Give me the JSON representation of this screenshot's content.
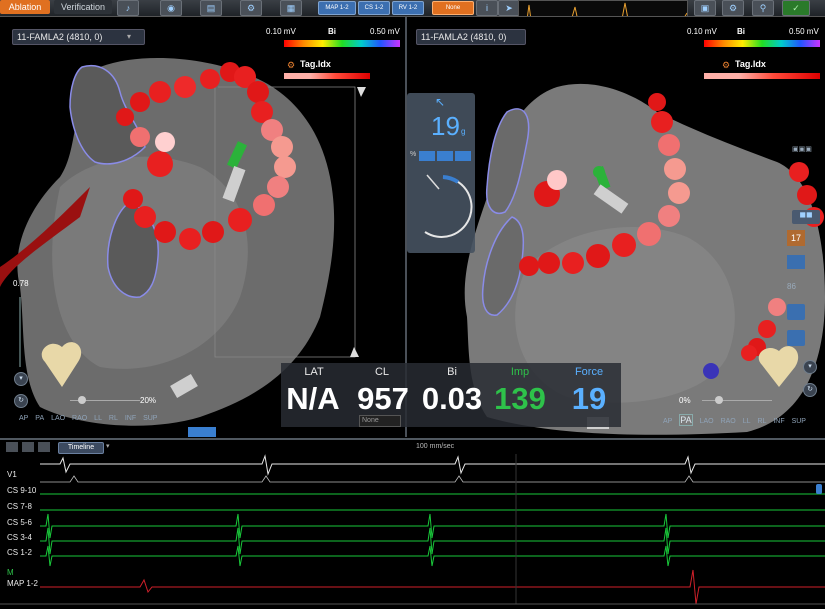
{
  "toolbar": {
    "tab_ablation": "Ablation",
    "tab_verification": "Verification",
    "buttons": [
      "MAP 1-2",
      "CS 1-2",
      "RV 1-2",
      "None"
    ]
  },
  "left_map": {
    "title": "11-FAMLA2 (4810, 0)",
    "scale_min": "0.10 mV",
    "scale_label": "Bi",
    "scale_max": "0.50 mV",
    "tag_label": "Tag.Idx",
    "slider_value": "0.78",
    "zoom": "20%",
    "orientation": [
      "AP",
      "PA",
      "LAO",
      "RAO",
      "LL",
      "RL",
      "INF",
      "SUP"
    ]
  },
  "right_map": {
    "title": "11-FAMLA2 (4810, 0)",
    "scale_min": "0.10 mV",
    "scale_label": "Bi",
    "scale_max": "0.50 mV",
    "tag_label": "Tag.Idx",
    "zoom": "0%",
    "orientation": [
      "AP",
      "PA",
      "LAO",
      "RAO",
      "LL",
      "RL",
      "INF",
      "SUP"
    ],
    "side_value_1": "17",
    "side_value_2": "86"
  },
  "force_panel": {
    "value": "19",
    "unit": "g",
    "percent_symbol": "%"
  },
  "metrics": {
    "lat_label": "LAT",
    "lat_value": "N/A",
    "cl_label": "CL",
    "cl_value": "957",
    "cl_select": "None",
    "bi_label": "Bi",
    "bi_value": "0.03",
    "imp_label": "Imp",
    "imp_value": "139",
    "force_label": "Force",
    "force_value": "19"
  },
  "ecg": {
    "timeline_label": "Timeline",
    "speed": "100 mm/sec",
    "channels": [
      "V1",
      "CS 9-10",
      "CS 7-8",
      "CS 5-6",
      "CS 3-4",
      "CS 1-2",
      "M",
      "MAP 1-2"
    ]
  },
  "colors": {
    "accent_orange": "#e07020",
    "force_blue": "#5ab0ff",
    "imp_green": "#2ec24a",
    "ecg_green": "#19c83a",
    "ecg_red": "#d0202a",
    "tag_red": "#e01010"
  }
}
